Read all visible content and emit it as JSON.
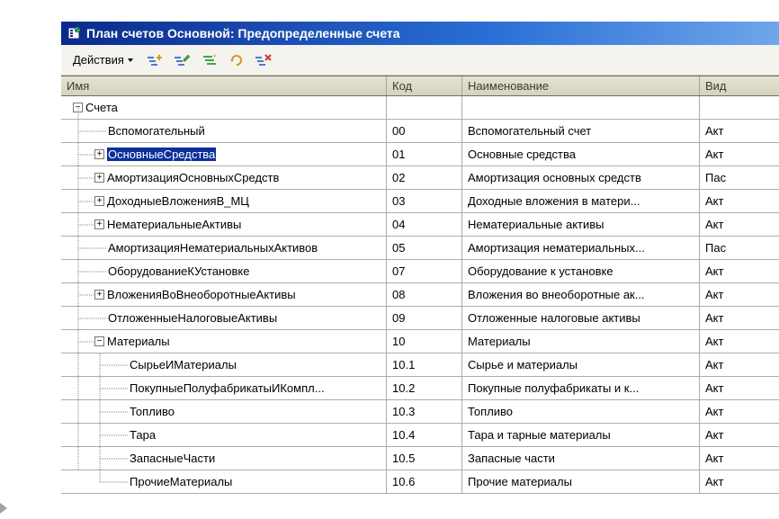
{
  "window": {
    "title": "План счетов Основной: Предопределенные счета"
  },
  "toolbar": {
    "actions_label": "Действия"
  },
  "grid": {
    "headers": {
      "name": "Имя",
      "code": "Код",
      "desc": "Наименование",
      "type": "Вид"
    },
    "rows": [
      {
        "level": 0,
        "expander": "-",
        "name": "Счета",
        "code": "",
        "desc": "",
        "type": "",
        "selected": false
      },
      {
        "level": 1,
        "expander": "",
        "name": "Вспомогательный",
        "code": "00",
        "desc": "Вспомогательный счет",
        "type": "Акт",
        "selected": false
      },
      {
        "level": 1,
        "expander": "+",
        "name": "ОсновныеСредства",
        "code": "01",
        "desc": "Основные средства",
        "type": "Акт",
        "selected": true
      },
      {
        "level": 1,
        "expander": "+",
        "name": "АмортизацияОсновныхСредств",
        "code": "02",
        "desc": "Амортизация основных средств",
        "type": "Пас",
        "selected": false
      },
      {
        "level": 1,
        "expander": "+",
        "name": "ДоходныеВложенияВ_МЦ",
        "code": "03",
        "desc": "Доходные вложения в матери...",
        "type": "Акт",
        "selected": false
      },
      {
        "level": 1,
        "expander": "+",
        "name": "НематериальныеАктивы",
        "code": "04",
        "desc": "Нематериальные активы",
        "type": "Акт",
        "selected": false
      },
      {
        "level": 1,
        "expander": "",
        "name": "АмортизацияНематериальныхАктивов",
        "code": "05",
        "desc": "Амортизация нематериальных...",
        "type": "Пас",
        "selected": false
      },
      {
        "level": 1,
        "expander": "",
        "name": "ОборудованиеКУстановке",
        "code": "07",
        "desc": "Оборудование к установке",
        "type": "Акт",
        "selected": false
      },
      {
        "level": 1,
        "expander": "+",
        "name": "ВложенияВоВнеоборотныеАктивы",
        "code": "08",
        "desc": "Вложения во внеоборотные ак...",
        "type": "Акт",
        "selected": false
      },
      {
        "level": 1,
        "expander": "",
        "name": "ОтложенныеНалоговыеАктивы",
        "code": "09",
        "desc": "Отложенные налоговые активы",
        "type": "Акт",
        "selected": false
      },
      {
        "level": 1,
        "expander": "-",
        "name": "Материалы",
        "code": "10",
        "desc": "Материалы",
        "type": "Акт",
        "selected": false
      },
      {
        "level": 2,
        "expander": "",
        "name": "СырьеИМатериалы",
        "code": "10.1",
        "desc": "Сырье и материалы",
        "type": "Акт",
        "selected": false
      },
      {
        "level": 2,
        "expander": "",
        "name": "ПокупныеПолуфабрикатыИКомпл...",
        "code": "10.2",
        "desc": "Покупные полуфабрикаты и к...",
        "type": "Акт",
        "selected": false
      },
      {
        "level": 2,
        "expander": "",
        "name": "Топливо",
        "code": "10.3",
        "desc": "Топливо",
        "type": "Акт",
        "selected": false
      },
      {
        "level": 2,
        "expander": "",
        "name": "Тара",
        "code": "10.4",
        "desc": "Тара и тарные материалы",
        "type": "Акт",
        "selected": false
      },
      {
        "level": 2,
        "expander": "",
        "name": "ЗапасныеЧасти",
        "code": "10.5",
        "desc": "Запасные части",
        "type": "Акт",
        "selected": false
      },
      {
        "level": 2,
        "expander": "",
        "name": "ПрочиеМатериалы",
        "code": "10.6",
        "desc": "Прочие материалы",
        "type": "Акт",
        "selected": false
      }
    ]
  }
}
